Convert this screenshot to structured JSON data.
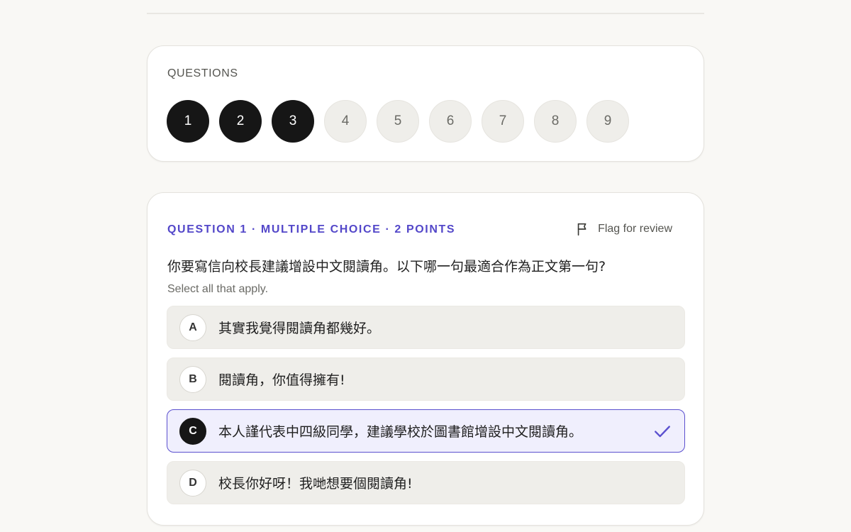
{
  "nav": {
    "title": "QUESTIONS",
    "items": [
      {
        "label": "1",
        "state": "answered"
      },
      {
        "label": "2",
        "state": "answered"
      },
      {
        "label": "3",
        "state": "answered"
      },
      {
        "label": "4",
        "state": "unanswered"
      },
      {
        "label": "5",
        "state": "unanswered"
      },
      {
        "label": "6",
        "state": "unanswered"
      },
      {
        "label": "7",
        "state": "unanswered"
      },
      {
        "label": "8",
        "state": "unanswered"
      },
      {
        "label": "9",
        "state": "unanswered"
      }
    ]
  },
  "question": {
    "meta": "QUESTION 1 · MULTIPLE CHOICE · 2 POINTS",
    "flag_label": "Flag for review",
    "prompt": "你要寫信向校長建議增設中文閱讀角。以下哪一句最適合作為正文第一句?",
    "hint": "Select all that apply.",
    "options": [
      {
        "letter": "A",
        "text": "其實我覺得閱讀角都幾好。",
        "selected": false
      },
      {
        "letter": "B",
        "text": "閱讀角，你值得擁有!",
        "selected": false
      },
      {
        "letter": "C",
        "text": "本人謹代表中四級同學，建議學校於圖書館增設中文閱讀角。",
        "selected": true
      },
      {
        "letter": "D",
        "text": "校長你好呀！我哋想要個閱讀角!",
        "selected": false
      }
    ]
  },
  "colors": {
    "accent": "#5347c9",
    "answered": "#161616",
    "background": "#f9f8f5"
  }
}
